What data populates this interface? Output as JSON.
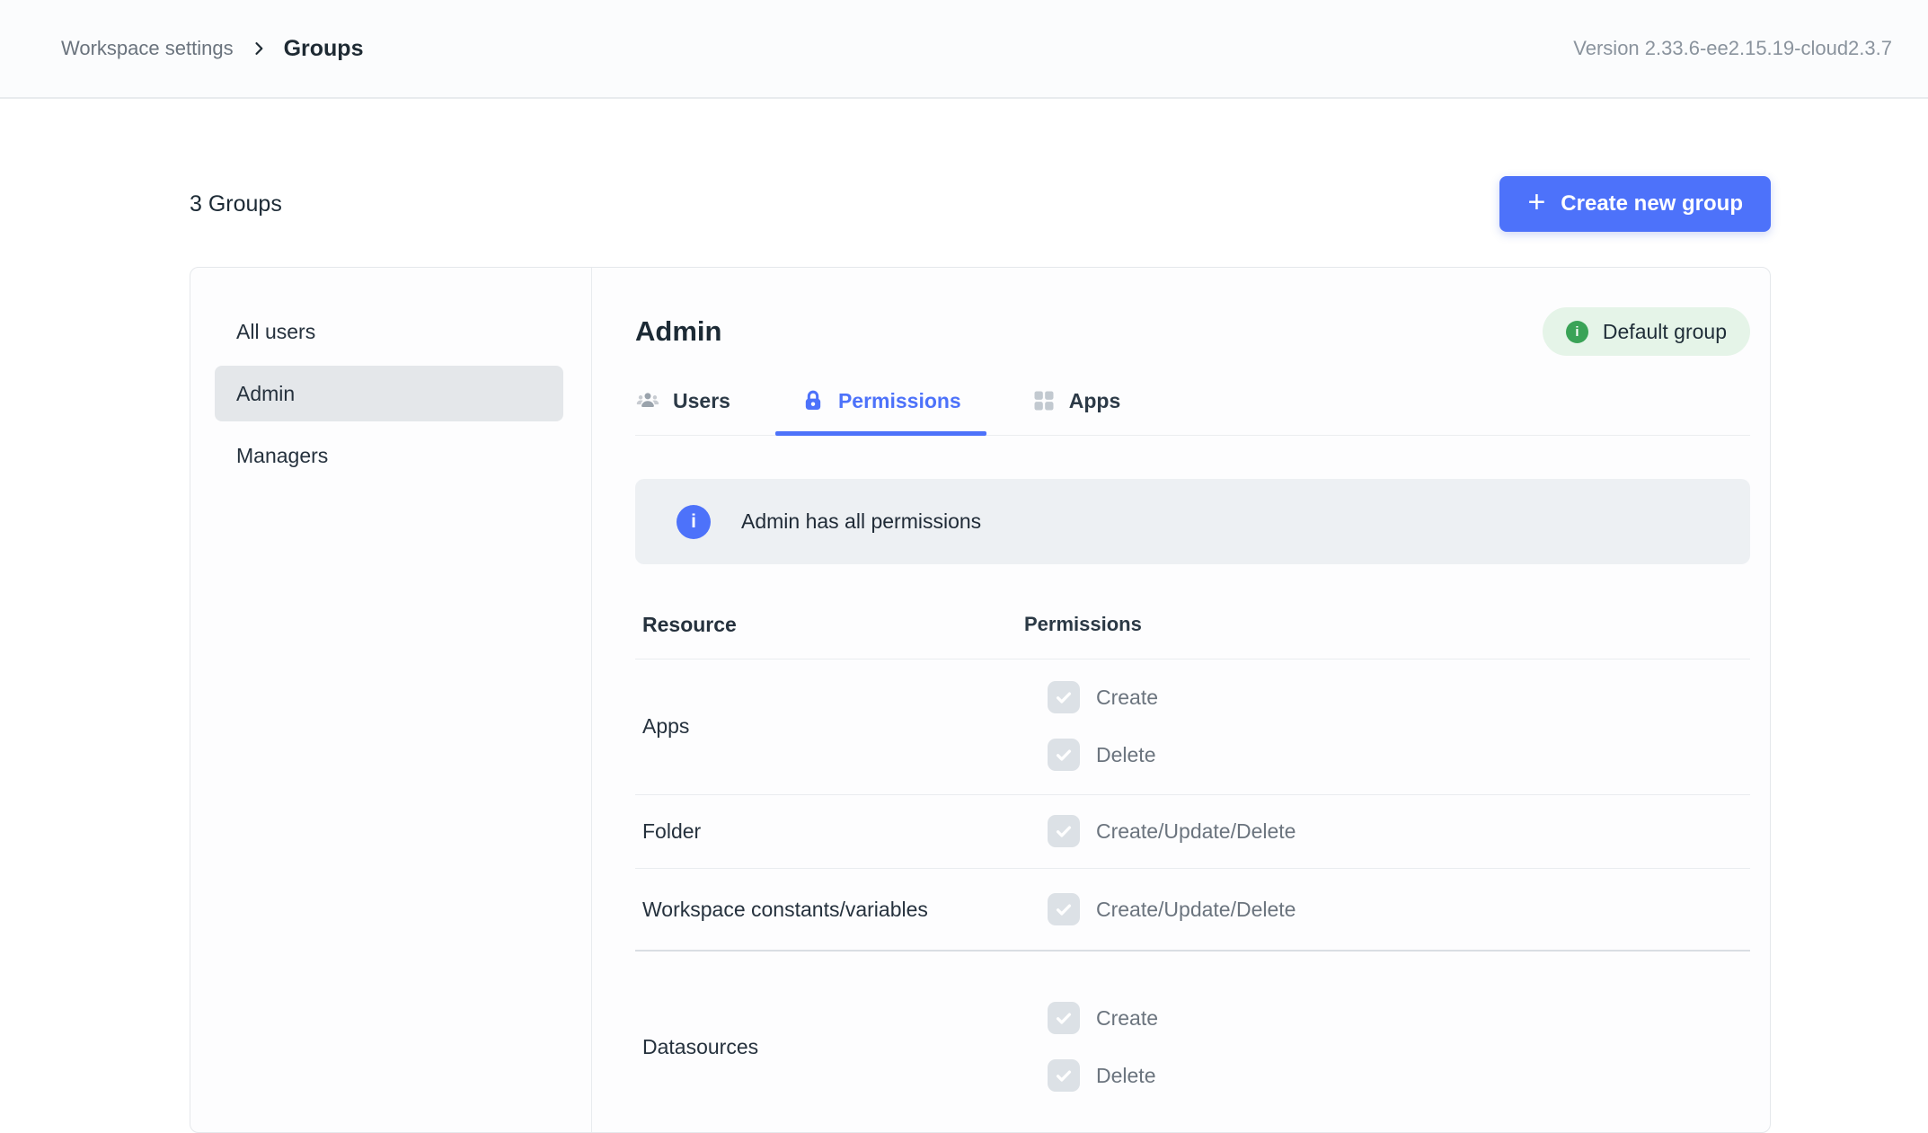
{
  "header": {
    "breadcrumb": {
      "parent": "Workspace settings",
      "current": "Groups"
    },
    "version": "Version 2.33.6-ee2.15.19-cloud2.3.7"
  },
  "toolbar": {
    "groups_count_label": "3 Groups",
    "create_button_plus": "+",
    "create_button_label": "Create new group"
  },
  "sidebar": {
    "items": [
      {
        "label": "All users",
        "selected": false
      },
      {
        "label": "Admin",
        "selected": true
      },
      {
        "label": "Managers",
        "selected": false
      }
    ]
  },
  "panel": {
    "title": "Admin",
    "badge": {
      "label": "Default group",
      "icon": "info-icon"
    },
    "tabs": [
      {
        "label": "Users",
        "icon": "users-icon",
        "active": false
      },
      {
        "label": "Permissions",
        "icon": "lock-icon",
        "active": true
      },
      {
        "label": "Apps",
        "icon": "grid-icon",
        "active": false
      }
    ],
    "banner": {
      "text": "Admin has all permissions",
      "icon": "info-icon"
    },
    "table": {
      "headers": {
        "resource": "Resource",
        "permissions": "Permissions"
      },
      "rows": [
        {
          "resource": "Apps",
          "permissions": [
            {
              "label": "Create",
              "checked": true
            },
            {
              "label": "Delete",
              "checked": true
            }
          ]
        },
        {
          "resource": "Folder",
          "permissions": [
            {
              "label": "Create/Update/Delete",
              "checked": true
            }
          ]
        },
        {
          "resource": "Workspace constants/variables",
          "thick_divider": true,
          "permissions": [
            {
              "label": "Create/Update/Delete",
              "checked": true
            }
          ]
        },
        {
          "resource": "Datasources",
          "permissions": [
            {
              "label": "Create",
              "checked": true
            },
            {
              "label": "Delete",
              "checked": true
            }
          ]
        }
      ]
    }
  },
  "icons": {
    "info_glyph": "i"
  },
  "colors": {
    "accent_blue": "#4d72fa",
    "badge_green": "#3aa357",
    "badge_bg": "#e5f4e8",
    "banner_bg": "#edf0f3",
    "selected_item_bg": "#e4e7ea",
    "checkbox_bg": "#dce1e6"
  }
}
